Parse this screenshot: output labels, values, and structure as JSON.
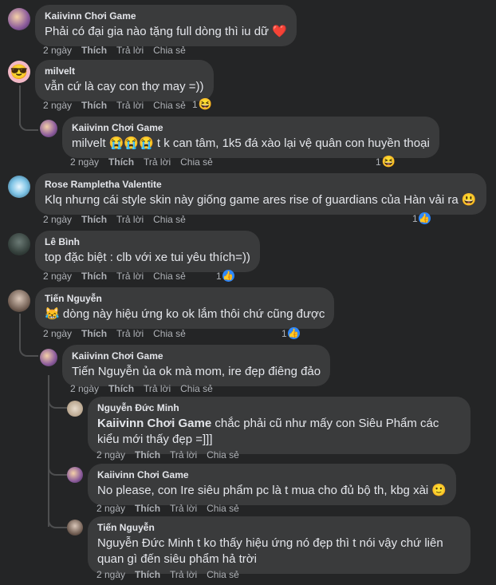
{
  "comments": [
    {
      "name": "Kaiivinn Chơi Game",
      "text": "Phải có đại gia nào tặng full dòng thì iu dữ",
      "emoji": "❤️",
      "time": "2 ngày",
      "like": "Thích",
      "reply": "Trả lời",
      "share": "Chia sẻ"
    },
    {
      "name": "milvelt",
      "text": "vẫn cứ là cay con thợ may =))",
      "time": "2 ngày",
      "like": "Thích",
      "reply": "Trả lời",
      "share": "Chia sẻ",
      "reactions": "1",
      "reaction_icon": "😆"
    },
    {
      "name": "Kaiivinn Chơi Game",
      "text_prefix": "milvelt",
      "emojis": "😭😭😭",
      "text": "t k can tâm, 1k5 đá xào lại vệ quân con huyền thoại",
      "time": "2 ngày",
      "like": "Thích",
      "reply": "Trả lời",
      "share": "Chia sẻ",
      "reactions": "1",
      "reaction_icon": "😆"
    },
    {
      "name": "Rose Rampletha Valentite",
      "text": "Klq nhưng cái style skin này giống game ares rise of guardians của Hàn vải ra",
      "emoji": "😃",
      "time": "2 ngày",
      "like": "Thích",
      "reply": "Trả lời",
      "share": "Chia sẻ",
      "reactions": "1",
      "reaction_icon": "👍"
    },
    {
      "name": "Lê Bình",
      "text": "top đặc biệt : clb với xe tui yêu thích=))",
      "time": "2 ngày",
      "like": "Thích",
      "reply": "Trả lời",
      "share": "Chia sẻ",
      "reactions": "1",
      "reaction_icon": "👍"
    },
    {
      "name": "Tiến Nguyễn",
      "emoji": "😹",
      "text": "dòng này hiệu ứng ko ok lắm thôi chứ cũng được",
      "time": "2 ngày",
      "like": "Thích",
      "reply": "Trả lời",
      "share": "Chia sẻ",
      "reactions": "1",
      "reaction_icon": "👍"
    },
    {
      "name": "Kaiivinn Chơi Game",
      "text": "Tiến Nguyễn ủa ok mà mom, ire đẹp điêng đảo",
      "time": "2 ngày",
      "like": "Thích",
      "reply": "Trả lời",
      "share": "Chia sẻ"
    },
    {
      "name": "Nguyễn Đức Minh",
      "mention": "Kaiivinn Chơi Game",
      "text": "chắc phải cũ như mấy con Siêu Phẩm các kiểu mới thấy đẹp =]]]",
      "time": "2 ngày",
      "like": "Thích",
      "reply": "Trả lời",
      "share": "Chia sẻ"
    },
    {
      "name": "Kaiivinn Chơi Game",
      "text": "No please, con Ire siêu phẩm pc là t mua cho đủ bộ th, kbg xài",
      "emoji": "🙂",
      "time": "2 ngày",
      "like": "Thích",
      "reply": "Trả lời",
      "share": "Chia sẻ"
    },
    {
      "name": "Tiến Nguyễn",
      "text": "Nguyễn Đức Minh t ko thấy hiệu ứng nó đẹp thì t nói vậy chứ liên quan gì đến siêu phẩm hả trời",
      "time": "2 ngày",
      "like": "Thích",
      "reply": "Trả lời",
      "share": "Chia sẻ"
    }
  ],
  "colors": {
    "bg": "#242526",
    "bubble": "#3a3b3c",
    "text": "#e4e6eb",
    "meta": "#b0b3b8",
    "heart": "#e41e3f",
    "like": "#2d88ff"
  }
}
